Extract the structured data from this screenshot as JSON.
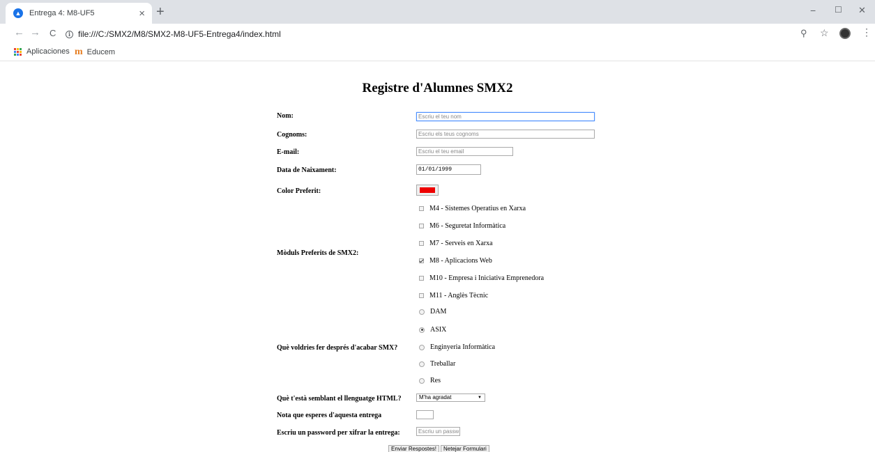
{
  "browser": {
    "tab_title": "Entrega 4: M8-UF5",
    "tab_close": "×",
    "new_tab": "+",
    "window": {
      "minimize": "−",
      "maximize": "☐",
      "close": "✕"
    },
    "nav": {
      "back": "←",
      "forward": "→",
      "reload": "C"
    },
    "url": "file:///C:/SMX2/M8/SMX2-M8-UF5-Entrega4/index.html",
    "toolbar_icons": {
      "zoom": "⚲",
      "star": "☆",
      "menu": "⋮"
    },
    "bookmarks": [
      {
        "label": "Aplicaciones",
        "icon": "apps-grid-icon"
      },
      {
        "label": "Educem",
        "icon": "educem-logo-icon",
        "logo_text": "m"
      }
    ],
    "apps_grid_colors": [
      "#ea4335",
      "#fbbc05",
      "#34a853",
      "#4285f4",
      "#ea4335",
      "#fbbc05",
      "#34a853",
      "#4285f4",
      "#ea4335"
    ]
  },
  "form": {
    "title": "Registre d'Alumnes SMX2",
    "nom": {
      "label": "Nom:",
      "placeholder": "Escriu el teu nom"
    },
    "cognoms": {
      "label": "Cognoms:",
      "placeholder": "Escriu els teus cognoms"
    },
    "email": {
      "label": "E-mail:",
      "placeholder": "Escriu el teu email"
    },
    "data_naixement": {
      "label": "Data de Naixament:",
      "value": "01/01/1999"
    },
    "color": {
      "label": "Color Preferit:",
      "value": "#ee0000"
    },
    "moduls": {
      "label": "Mòduls Preferits de SMX2:",
      "options": [
        {
          "label": "M4 - Sistemes Operatius en Xarxa",
          "checked": false
        },
        {
          "label": "M6 - Seguretat Informàtica",
          "checked": false
        },
        {
          "label": "M7 - Serveis en Xarxa",
          "checked": false
        },
        {
          "label": "M8 - Aplicacions Web",
          "checked": true
        },
        {
          "label": "M10 - Empresa i Iniciativa Emprenedora",
          "checked": false
        },
        {
          "label": "M11 - Anglès Tècnic",
          "checked": false
        }
      ]
    },
    "despres": {
      "label": "Què voldries fer després d'acabar SMX?",
      "options": [
        {
          "label": "DAM",
          "checked": false
        },
        {
          "label": "ASIX",
          "checked": true
        },
        {
          "label": "Enginyeria Informàtica",
          "checked": false
        },
        {
          "label": "Treballar",
          "checked": false
        },
        {
          "label": "Res",
          "checked": false
        }
      ]
    },
    "html_opinion": {
      "label": "Què t'està semblant el llenguatge HTML?",
      "selected": "M'ha agradat",
      "arrow": "▼"
    },
    "nota": {
      "label": "Nota que esperes d'aquesta entrega",
      "value": ""
    },
    "password": {
      "label": "Escriu un password per xifrar la entrega:",
      "placeholder": "Escriu un passw"
    },
    "submit_label": "Enviar Respostes!",
    "reset_label": "Netejar Formulari"
  }
}
